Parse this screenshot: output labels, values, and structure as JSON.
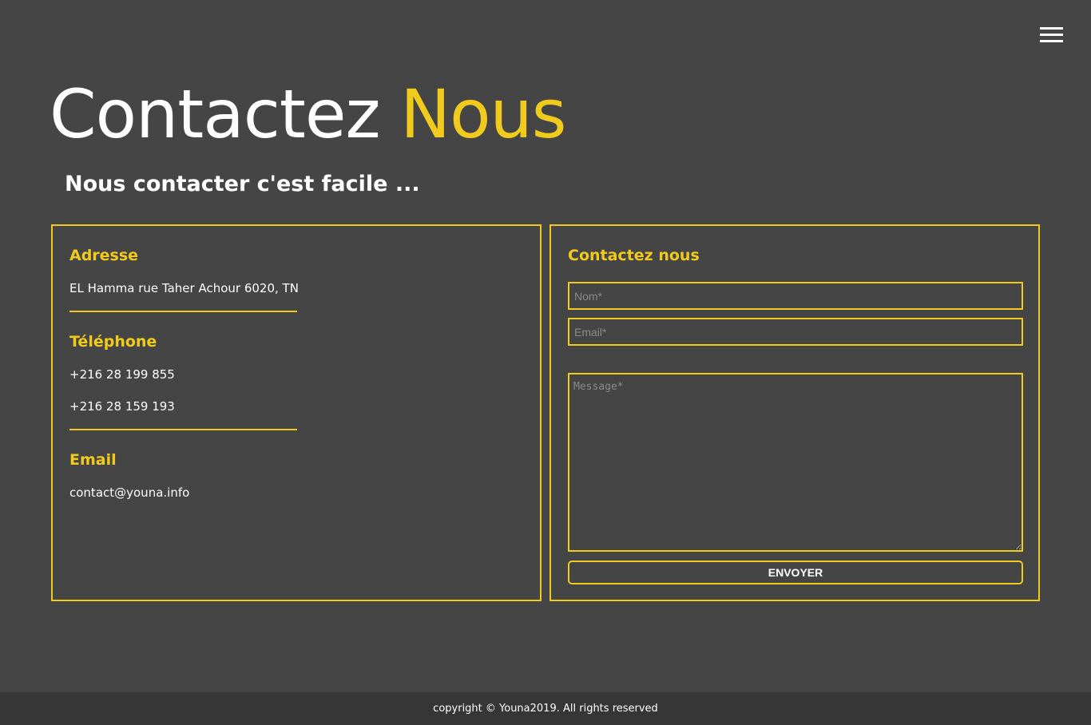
{
  "header": {
    "menu_icon": "hamburger-menu-icon",
    "title_part1": "Contactez",
    "title_part2": "Nous",
    "subtitle": "Nous contacter c'est facile ..."
  },
  "info": {
    "address": {
      "title": "Adresse",
      "value": "EL Hamma rue Taher Achour 6020, TN"
    },
    "phone": {
      "title": "Téléphone",
      "numbers": [
        "+216 28 199 855",
        "+216 28 159 193"
      ]
    },
    "email": {
      "title": "Email",
      "value": "contact@youna.info"
    }
  },
  "form": {
    "title": "Contactez nous",
    "name_placeholder": "Nom*",
    "email_placeholder": "Email*",
    "message_placeholder": "Message*",
    "submit_label": "ENVOYER"
  },
  "footer": {
    "text": "copyright © Youna2019. All rights reserved"
  },
  "colors": {
    "accent": "#f0cb1d",
    "background": "#454545",
    "footer": "#363636"
  }
}
